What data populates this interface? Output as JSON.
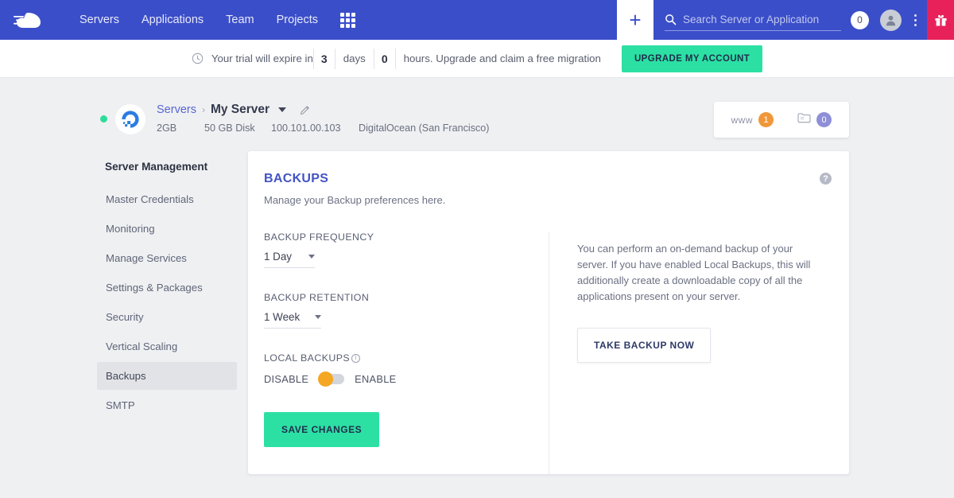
{
  "topnav": {
    "brand_icon": "cloudways-logo-icon",
    "links": [
      {
        "label": "Servers"
      },
      {
        "label": "Applications"
      },
      {
        "label": "Team"
      },
      {
        "label": "Projects"
      }
    ],
    "apps_grid_icon": "apps-grid-icon",
    "plus_label": "+",
    "search": {
      "placeholder": "Search Server or Application",
      "value": "",
      "icon": "search-icon"
    },
    "notification_count": "0",
    "avatar_icon": "user-avatar-icon",
    "kebab_icon": "more-vertical-icon",
    "gift_icon": "gift-icon",
    "colors": {
      "nav_bg": "#3b4ec9",
      "gift_bg": "#e8215a"
    }
  },
  "trial": {
    "clock_icon": "clock-icon",
    "text_before": "Your trial will expire in",
    "days_value": "3",
    "days_unit": "days",
    "hours_value": "0",
    "text_after": "hours. Upgrade and claim a free migration",
    "upgrade_label": "UPGRADE MY ACCOUNT",
    "upgrade_color": "#2ce0a4"
  },
  "server_header": {
    "status": "online",
    "provider_icon": "digitalocean-logo-icon",
    "breadcrumb_parent": "Servers",
    "breadcrumb_sep": "›",
    "server_name": "My Server",
    "dropdown_icon": "chevron-down-icon",
    "edit_icon": "pencil-edit-icon",
    "ram": "2GB",
    "disk": "50 GB Disk",
    "ip": "100.101.00.103",
    "provider": "DigitalOcean (San Francisco)",
    "counts": [
      {
        "label": "www",
        "value": "1",
        "color": "#f0973a",
        "icon": "www-icon"
      },
      {
        "label": "",
        "value": "0",
        "color": "#8e8fd8",
        "icon": "folder-icon"
      }
    ]
  },
  "sidebar": {
    "title": "Server Management",
    "items": [
      {
        "label": "Master Credentials",
        "active": false
      },
      {
        "label": "Monitoring",
        "active": false
      },
      {
        "label": "Manage Services",
        "active": false
      },
      {
        "label": "Settings & Packages",
        "active": false
      },
      {
        "label": "Security",
        "active": false
      },
      {
        "label": "Vertical Scaling",
        "active": false
      },
      {
        "label": "Backups",
        "active": true
      },
      {
        "label": "SMTP",
        "active": false
      }
    ]
  },
  "card": {
    "title": "BACKUPS",
    "subtitle": "Manage your Backup preferences here.",
    "help_icon": "help-question-icon",
    "help_label": "?",
    "fields": {
      "frequency_label": "BACKUP FREQUENCY",
      "frequency_value": "1 Day",
      "retention_label": "BACKUP RETENTION",
      "retention_value": "1 Week",
      "local_backups_label": "LOCAL BACKUPS",
      "local_backups_info_icon": "info-circle-icon",
      "toggle_off_label": "DISABLE",
      "toggle_on_label": "ENABLE",
      "toggle_state": "disabled",
      "toggle_knob_color": "#f5a623"
    },
    "save_label": "SAVE CHANGES",
    "right_panel": {
      "description": "You can perform an on-demand backup of your server. If you have enabled Local Backups, this will additionally create a downloadable copy of all the applications present on your server.",
      "take_backup_label": "TAKE BACKUP NOW"
    }
  }
}
